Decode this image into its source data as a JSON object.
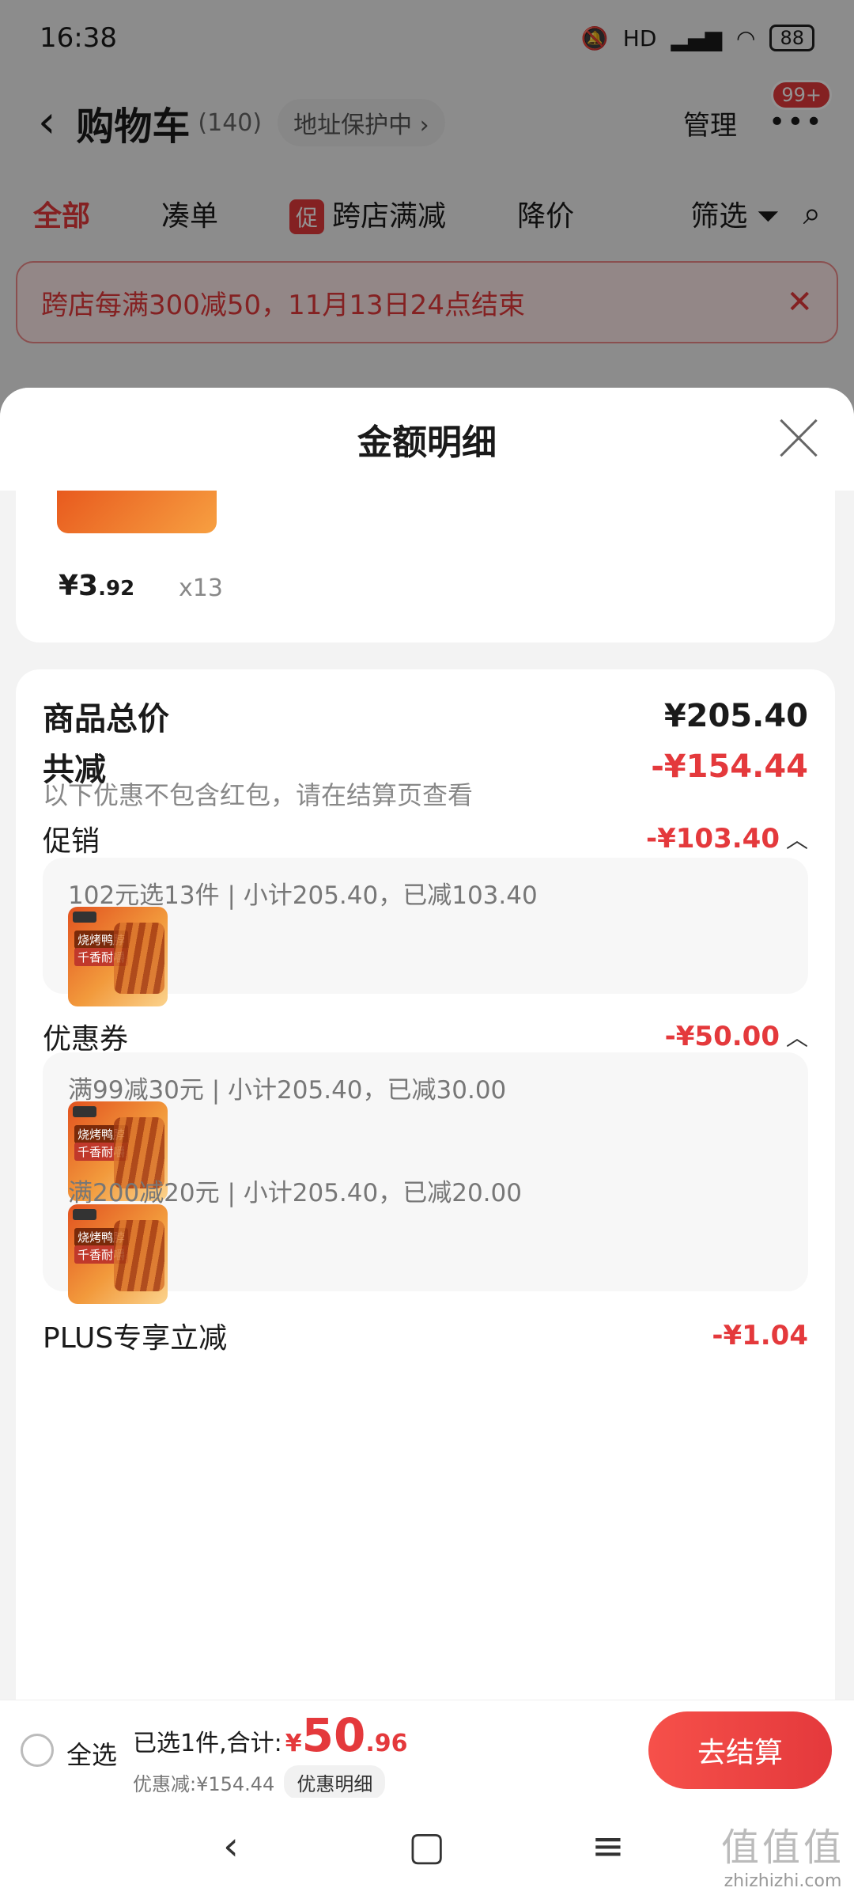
{
  "status_bar": {
    "time": "16:38",
    "network_label": "HD",
    "battery": "88"
  },
  "header": {
    "back_glyph": "‹",
    "title": "购物车",
    "count": "(140)",
    "address_pill": "地址保护中 ›",
    "manage": "管理",
    "badge": "99+"
  },
  "tabs": [
    {
      "label": "全部"
    },
    {
      "label": "凑单"
    },
    {
      "mark": "促",
      "label": "跨店满减"
    },
    {
      "label": "降价"
    },
    {
      "label": "筛选"
    }
  ],
  "promo_banner": "跨店每满300减50，11月13日24点结束",
  "sheet": {
    "title": "金额明细",
    "item": {
      "price_int": "¥3",
      "price_dec": ".92",
      "qty": "x13"
    },
    "total_label": "商品总价",
    "total_value": "¥205.40",
    "reduce_label": "共减",
    "reduce_value": "-¥154.44",
    "reduce_note": "以下优惠不包含红包，请在结算页查看",
    "promo": {
      "label": "促销",
      "value": "-¥103.40",
      "line": "102元选13件 | 小计205.40，已减103.40"
    },
    "coupon": {
      "label": "优惠券",
      "value": "-¥50.00",
      "lines": [
        "满99减30元 | 小计205.40，已减30.00",
        "满200减20元 | 小计205.40，已减20.00"
      ]
    },
    "plus": {
      "label": "PLUS专享立减",
      "value": "-¥1.04"
    },
    "thumb_tag1": "烧烤鸭脖",
    "thumb_tag2": "千香耐嚼"
  },
  "bottom_bar": {
    "select_all": "全选",
    "summary_prefix": "已选1件,合计:",
    "currency": "¥",
    "amount_int": "50",
    "amount_dec": ".96",
    "discount_text": "优惠减:¥154.44",
    "detail_pill": "优惠明细",
    "checkout": "去结算"
  },
  "watermark": {
    "main": "值值值",
    "sub": "zhizhizhi.com"
  }
}
